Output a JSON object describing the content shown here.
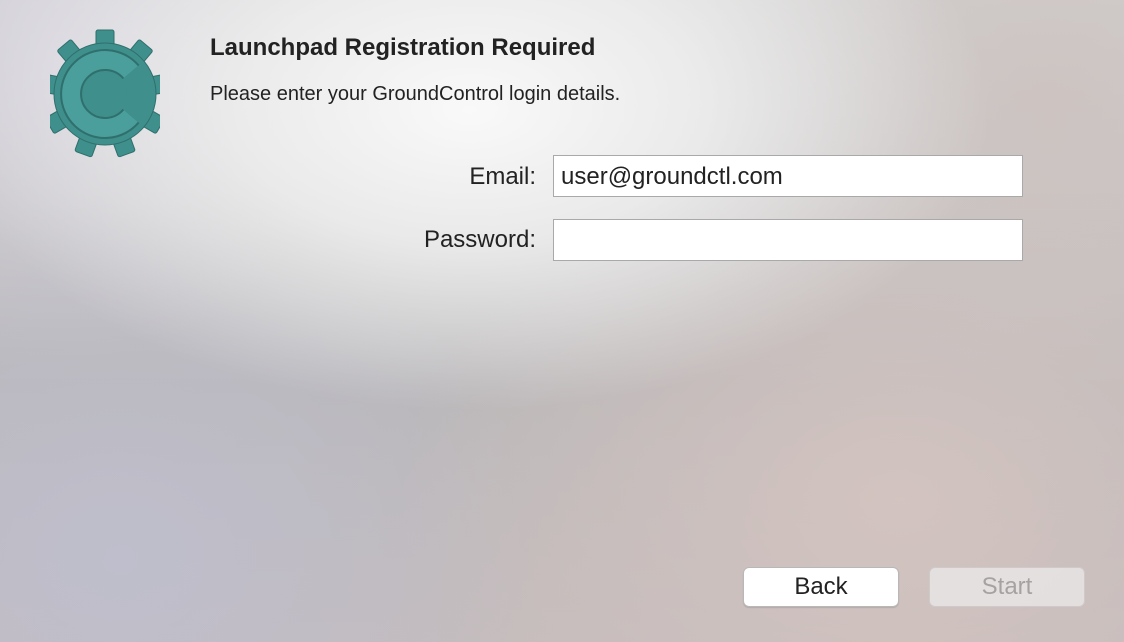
{
  "logo": {
    "icon": "gear-c-logo-icon",
    "color": "#3f8f8c"
  },
  "header": {
    "title": "Launchpad Registration Required",
    "subtitle": "Please enter your GroundControl login details."
  },
  "form": {
    "email": {
      "label": "Email:",
      "value": "user@groundctl.com"
    },
    "password": {
      "label": "Password:",
      "value": ""
    }
  },
  "buttons": {
    "back_label": "Back",
    "start_label": "Start",
    "start_enabled": false
  }
}
